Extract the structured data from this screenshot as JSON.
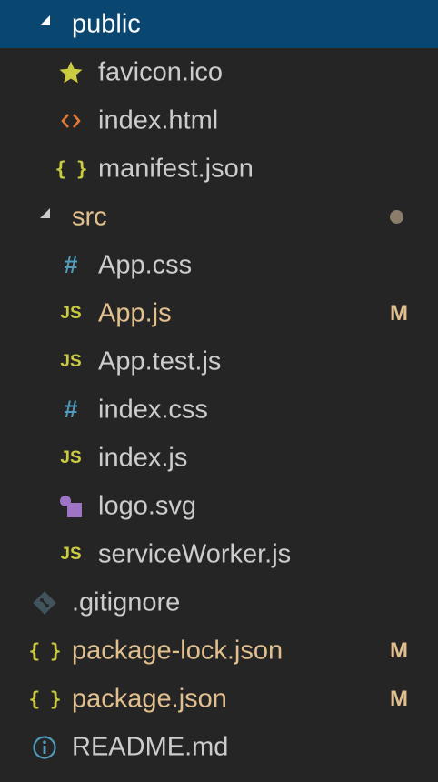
{
  "explorer": {
    "colors": {
      "background": "#252526",
      "selection": "#094771",
      "modified": "#e2c08d",
      "untracked_dot": "#8b7d6b",
      "default_text": "#cccccc",
      "json_icon": "#cbcb41",
      "js_icon": "#cbcb41",
      "css_icon": "#519aba",
      "html_icon": "#e37933",
      "star_icon": "#cbcb41",
      "svg_icon": "#a074c4",
      "git_icon": "#41535b",
      "info_icon": "#519aba"
    },
    "items": [
      {
        "label": "public",
        "type": "folder",
        "expanded": true,
        "selected": true,
        "icon": "",
        "status": ""
      },
      {
        "label": "favicon.ico",
        "type": "file",
        "icon": "star-icon",
        "status": ""
      },
      {
        "label": "index.html",
        "type": "file",
        "icon": "html-icon",
        "status": ""
      },
      {
        "label": "manifest.json",
        "type": "file",
        "icon": "json-icon",
        "status": ""
      },
      {
        "label": "src",
        "type": "folder",
        "expanded": true,
        "icon": "",
        "status": "dot"
      },
      {
        "label": "App.css",
        "type": "file",
        "icon": "css-icon",
        "status": ""
      },
      {
        "label": "App.js",
        "type": "file",
        "icon": "js-icon",
        "status": "M"
      },
      {
        "label": "App.test.js",
        "type": "file",
        "icon": "js-icon",
        "status": ""
      },
      {
        "label": "index.css",
        "type": "file",
        "icon": "css-icon",
        "status": ""
      },
      {
        "label": "index.js",
        "type": "file",
        "icon": "js-icon",
        "status": ""
      },
      {
        "label": "logo.svg",
        "type": "file",
        "icon": "svg-icon",
        "status": ""
      },
      {
        "label": "serviceWorker.js",
        "type": "file",
        "icon": "js-icon",
        "status": ""
      },
      {
        "label": ".gitignore",
        "type": "file",
        "icon": "git-icon",
        "status": ""
      },
      {
        "label": "package-lock.json",
        "type": "file",
        "icon": "json-icon",
        "status": "M"
      },
      {
        "label": "package.json",
        "type": "file",
        "icon": "json-icon",
        "status": "M"
      },
      {
        "label": "README.md",
        "type": "file",
        "icon": "info-icon",
        "status": ""
      }
    ],
    "icon_glyphs": {
      "js": "JS",
      "css": "#",
      "json": "{ }",
      "html": "<>"
    }
  }
}
